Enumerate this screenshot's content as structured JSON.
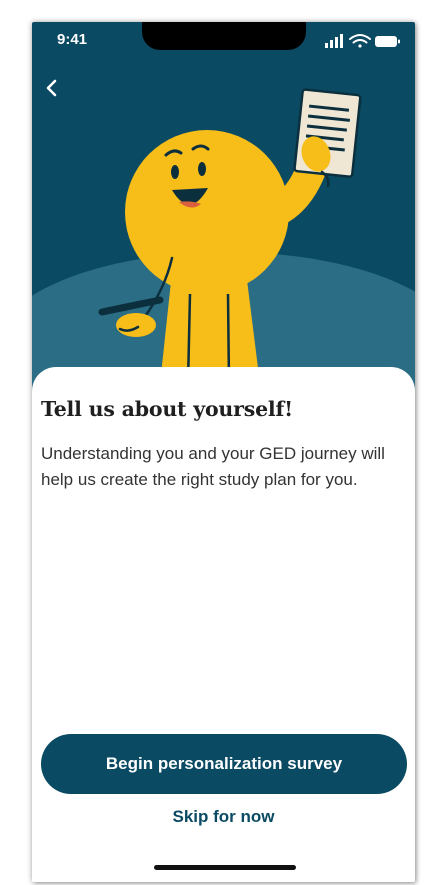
{
  "status_bar": {
    "time": "9:41",
    "icons": [
      "cellular-signal-icon",
      "wifi-icon",
      "battery-icon"
    ]
  },
  "header": {
    "back_icon": "chevron-left-icon"
  },
  "hero": {
    "illustration": "smiling yellow character holding a document",
    "colors": {
      "background": "#0b4a63",
      "hill": "#2a6d84",
      "character": "#f7bd19",
      "paper": "#efe6d3"
    }
  },
  "content": {
    "title": "Tell us about yourself!",
    "description": "Understanding you and your GED journey will help us create the right study plan for you."
  },
  "actions": {
    "primary_label": "Begin personalization survey",
    "secondary_label": "Skip for now"
  },
  "colors": {
    "primary": "#0b4a63",
    "text": "#1f1f1f",
    "body_text": "#333333",
    "surface": "#ffffff"
  }
}
